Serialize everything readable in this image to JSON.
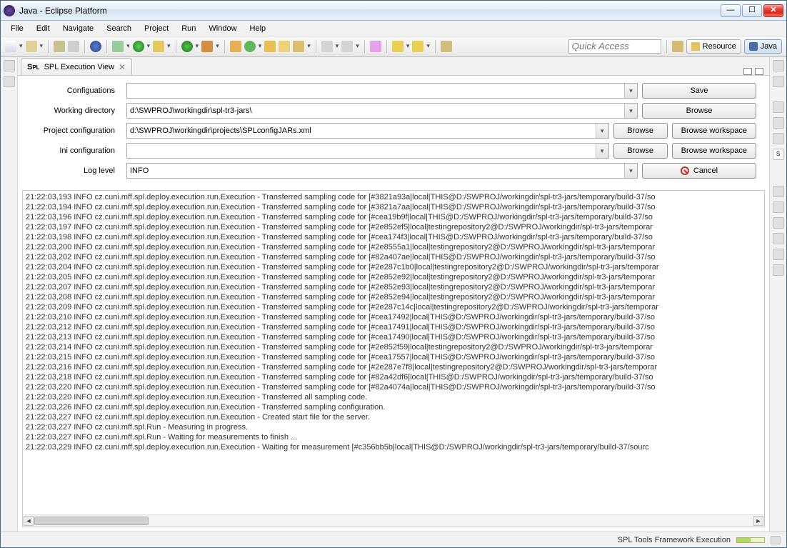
{
  "window": {
    "title": "Java - Eclipse Platform"
  },
  "menu": [
    "File",
    "Edit",
    "Navigate",
    "Search",
    "Project",
    "Run",
    "Window",
    "Help"
  ],
  "quick_access_placeholder": "Quick Access",
  "perspectives": {
    "resource": "Resource",
    "java": "Java"
  },
  "view": {
    "tab_title": "SPL Execution View"
  },
  "form": {
    "configs_label": "Configuations",
    "configs_value": "",
    "save": "Save",
    "wd_label": "Working directory",
    "wd_value": "d:\\SWPROJ\\workingdir\\spl-tr3-jars\\",
    "browse": "Browse",
    "proj_label": "Project configuration",
    "proj_value": "d:\\SWPROJ\\workingdir\\projects\\SPLconfigJARs.xml",
    "browse_ws": "Browse workspace",
    "ini_label": "Ini configuration",
    "ini_value": "",
    "log_label": "Log level",
    "log_value": "INFO",
    "cancel": "Cancel"
  },
  "log_lines": [
    "21:22:03,193 INFO cz.cuni.mff.spl.deploy.execution.run.Execution - Transferred sampling code for [#3821a93a|local|THIS@D:/SWPROJ/workingdir/spl-tr3-jars/temporary/build-37/so",
    "21:22:03,194 INFO cz.cuni.mff.spl.deploy.execution.run.Execution - Transferred sampling code for [#3821a7aa|local|THIS@D:/SWPROJ/workingdir/spl-tr3-jars/temporary/build-37/so",
    "21:22:03,196 INFO cz.cuni.mff.spl.deploy.execution.run.Execution - Transferred sampling code for [#cea19b9f|local|THIS@D:/SWPROJ/workingdir/spl-tr3-jars/temporary/build-37/so",
    "21:22:03,197 INFO cz.cuni.mff.spl.deploy.execution.run.Execution - Transferred sampling code for [#2e852ef5|local|testingrepository2@D:/SWPROJ/workingdir/spl-tr3-jars/temporar",
    "21:22:03,198 INFO cz.cuni.mff.spl.deploy.execution.run.Execution - Transferred sampling code for [#cea174f3|local|THIS@D:/SWPROJ/workingdir/spl-tr3-jars/temporary/build-37/so",
    "21:22:03,200 INFO cz.cuni.mff.spl.deploy.execution.run.Execution - Transferred sampling code for [#2e8555a1|local|testingrepository2@D:/SWPROJ/workingdir/spl-tr3-jars/temporar",
    "21:22:03,202 INFO cz.cuni.mff.spl.deploy.execution.run.Execution - Transferred sampling code for [#82a407ae|local|THIS@D:/SWPROJ/workingdir/spl-tr3-jars/temporary/build-37/so",
    "21:22:03,204 INFO cz.cuni.mff.spl.deploy.execution.run.Execution - Transferred sampling code for [#2e287c1b0|local|testingrepository2@D:/SWPROJ/workingdir/spl-tr3-jars/temporar",
    "21:22:03,205 INFO cz.cuni.mff.spl.deploy.execution.run.Execution - Transferred sampling code for [#2e852e92|local|testingrepository2@D:/SWPROJ/workingdir/spl-tr3-jars/temporar",
    "21:22:03,207 INFO cz.cuni.mff.spl.deploy.execution.run.Execution - Transferred sampling code for [#2e852e93|local|testingrepository2@D:/SWPROJ/workingdir/spl-tr3-jars/temporar",
    "21:22:03,208 INFO cz.cuni.mff.spl.deploy.execution.run.Execution - Transferred sampling code for [#2e852e94|local|testingrepository2@D:/SWPROJ/workingdir/spl-tr3-jars/temporar",
    "21:22:03,209 INFO cz.cuni.mff.spl.deploy.execution.run.Execution - Transferred sampling code for [#2e287c14c|local|testingrepository2@D:/SWPROJ/workingdir/spl-tr3-jars/temporar",
    "21:22:03,210 INFO cz.cuni.mff.spl.deploy.execution.run.Execution - Transferred sampling code for [#cea17492|local|THIS@D:/SWPROJ/workingdir/spl-tr3-jars/temporary/build-37/so",
    "21:22:03,212 INFO cz.cuni.mff.spl.deploy.execution.run.Execution - Transferred sampling code for [#cea17491|local|THIS@D:/SWPROJ/workingdir/spl-tr3-jars/temporary/build-37/so",
    "21:22:03,213 INFO cz.cuni.mff.spl.deploy.execution.run.Execution - Transferred sampling code for [#cea17490|local|THIS@D:/SWPROJ/workingdir/spl-tr3-jars/temporary/build-37/so",
    "21:22:03,214 INFO cz.cuni.mff.spl.deploy.execution.run.Execution - Transferred sampling code for [#2e852f59|local|testingrepository2@D:/SWPROJ/workingdir/spl-tr3-jars/temporar",
    "21:22:03,215 INFO cz.cuni.mff.spl.deploy.execution.run.Execution - Transferred sampling code for [#cea17557|local|THIS@D:/SWPROJ/workingdir/spl-tr3-jars/temporary/build-37/so",
    "21:22:03,216 INFO cz.cuni.mff.spl.deploy.execution.run.Execution - Transferred sampling code for [#2e287e7f8|local|testingrepository2@D:/SWPROJ/workingdir/spl-tr3-jars/temporar",
    "21:22:03,218 INFO cz.cuni.mff.spl.deploy.execution.run.Execution - Transferred sampling code for [#82a42df6|local|THIS@D:/SWPROJ/workingdir/spl-tr3-jars/temporary/build-37/so",
    "21:22:03,220 INFO cz.cuni.mff.spl.deploy.execution.run.Execution - Transferred sampling code for [#82a4074a|local|THIS@D:/SWPROJ/workingdir/spl-tr3-jars/temporary/build-37/so",
    "21:22:03,220 INFO cz.cuni.mff.spl.deploy.execution.run.Execution - Transferred all sampling code.",
    "21:22:03,226 INFO cz.cuni.mff.spl.deploy.execution.run.Execution - Transferred sampling configuration.",
    "21:22:03,227 INFO cz.cuni.mff.spl.deploy.execution.run.Execution - Created start file for the server.",
    "21:22:03,227 INFO cz.cuni.mff.spl.Run - Measuring in progress.",
    "21:22:03,227 INFO cz.cuni.mff.spl.Run - Waiting for measurements to finish ...",
    "21:22:03,229 INFO cz.cuni.mff.spl.deploy.execution.run.Execution - Waiting for measurement [#c356bb5b|local|THIS@D:/SWPROJ/workingdir/spl-tr3-jars/temporary/build-37/sourc"
  ],
  "status": "SPL Tools Framework Execution"
}
